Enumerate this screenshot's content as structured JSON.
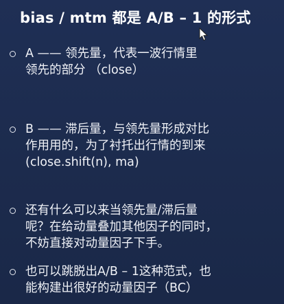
{
  "slide": {
    "title": "bias / mtm 都是 A/B – 1 的形式",
    "bullets": [
      {
        "lines": [
          "A —— 领先量，代表一波行情里",
          "领先的部分 （close）"
        ]
      },
      {
        "lines": [
          "B —— 滞后量，与领先量形成对比",
          "作用用的，为了衬托出行情的到来",
          "(close.shift(n), ma)"
        ]
      },
      {
        "lines": [
          "还有什么可以来当领先量/滞后量",
          "呢？在给动量叠加其他因子的同时，",
          "不妨直接对动量因子下手。"
        ]
      },
      {
        "lines": [
          "也可以跳脱出A/B – 1这种范式，也",
          "能构建出很好的动量因子（BC）"
        ]
      }
    ]
  },
  "colors": {
    "background": "#1d2c4f",
    "text": "#f0f2f7"
  },
  "icons": {
    "cursor": "mouse-pointer-icon",
    "bullet": "hollow-circle-bullet-icon"
  }
}
